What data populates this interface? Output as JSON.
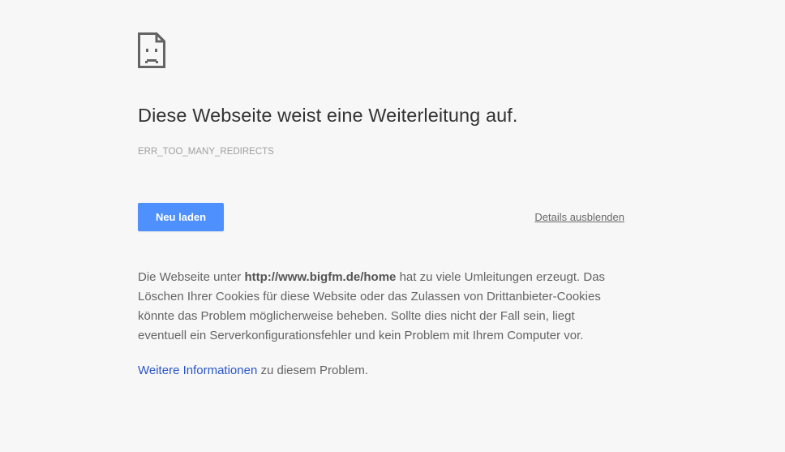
{
  "page": {
    "icon": "sad-document-icon",
    "title": "Diese Webseite weist eine Weiterleitung auf.",
    "error_code": "ERR_TOO_MANY_REDIRECTS"
  },
  "actions": {
    "reload_label": "Neu laden",
    "details_toggle_label": "Details ausblenden"
  },
  "details": {
    "text_before_url": "Die Webseite unter ",
    "url": "http://www.bigfm.de/home",
    "text_after_url": " hat zu viele Umleitungen erzeugt. Das Löschen Ihrer Cookies für diese Website oder das Zulassen von Drittanbieter-Cookies könnte das Problem möglicherweise beheben. Sollte dies nicht der Fall sein, liegt eventuell ein Serverkonfigurationsfehler und kein Problem mit Ihrem Computer vor."
  },
  "more_info": {
    "link_label": "Weitere Informationen",
    "suffix": " zu diesem Problem."
  },
  "colors": {
    "background": "#f7f7f7",
    "button_blue": "#4d90fe",
    "link_blue": "#2a56c6",
    "title_text": "#333333",
    "body_text": "#646464"
  }
}
